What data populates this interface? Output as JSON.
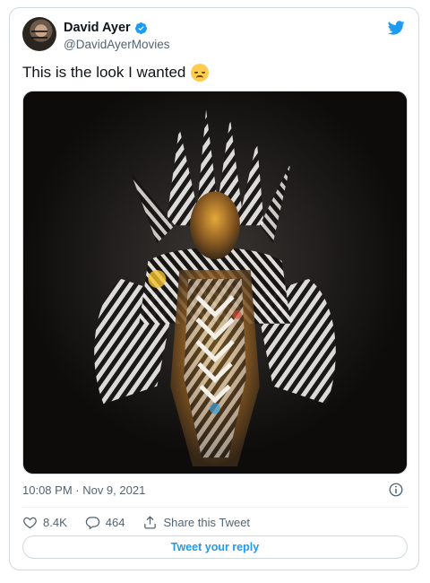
{
  "author": {
    "display_name": "David Ayer",
    "handle": "@DavidAyerMovies",
    "avatar_icon": "avatar-photo",
    "verified_icon": "verified-badge-icon"
  },
  "tweet": {
    "text": "This is the look I wanted",
    "emoji": "relieved-face-emoji",
    "timestamp": "10:08 PM · Nov 9, 2021"
  },
  "actions": {
    "like_count": "8.4K",
    "reply_count": "464",
    "share_label": "Share this Tweet",
    "reply_button_label": "Tweet your reply"
  },
  "colors": {
    "brand": "#1d9bf0",
    "text": "#0f1419",
    "muted": "#536471",
    "border": "#cfd9de"
  }
}
